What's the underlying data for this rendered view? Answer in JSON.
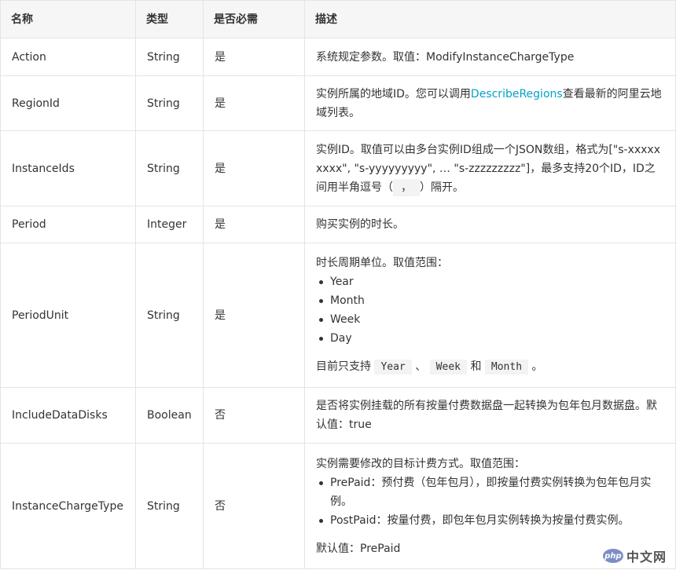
{
  "header": {
    "name": "名称",
    "type": "类型",
    "required": "是否必需",
    "description": "描述"
  },
  "rows": [
    {
      "name": "Action",
      "type": "String",
      "required": "是",
      "desc": "系统规定参数。取值：ModifyInstanceChargeType"
    },
    {
      "name": "RegionId",
      "type": "String",
      "required": "是",
      "desc_before": "实例所属的地域ID。您可以调用",
      "desc_link": "DescribeRegions",
      "desc_after": "查看最新的阿里云地域列表。"
    },
    {
      "name": "InstanceIds",
      "type": "String",
      "required": "是",
      "desc_before": "实例ID。取值可以由多台实例ID组成一个JSON数组，格式为[\"s-xxxxxxxxx\", \"s-yyyyyyyyy\", … \"s-zzzzzzzzz\"]，最多支持20个ID，ID之间用半角逗号（",
      "desc_code": "，",
      "desc_after": "）隔开。"
    },
    {
      "name": "Period",
      "type": "Integer",
      "required": "是",
      "desc": "购买实例的时长。"
    },
    {
      "name": "PeriodUnit",
      "type": "String",
      "required": "是",
      "desc_intro": "时长周期单位。取值范围：",
      "items": [
        "Year",
        "Month",
        "Week",
        "Day"
      ],
      "note_before": "目前只支持",
      "note_code1": "Year",
      "note_sep": "、",
      "note_code2": "Week",
      "note_and": "和",
      "note_code3": "Month",
      "note_end": "。"
    },
    {
      "name": "IncludeDataDisks",
      "type": "Boolean",
      "required": "否",
      "desc": "是否将实例挂载的所有按量付费数据盘一起转换为包年包月数据盘。默认值：true"
    },
    {
      "name": "InstanceChargeType",
      "type": "String",
      "required": "否",
      "desc_intro": "实例需要修改的目标计费方式。取值范围：",
      "items": [
        "PrePaid：预付费（包年包月），即按量付费实例转换为包年包月实例。",
        "PostPaid：按量付费，即包年包月实例转换为按量付费实例。"
      ],
      "default_text": "默认值：PrePaid"
    }
  ],
  "watermark": {
    "logo": "php",
    "text": "中文网"
  }
}
